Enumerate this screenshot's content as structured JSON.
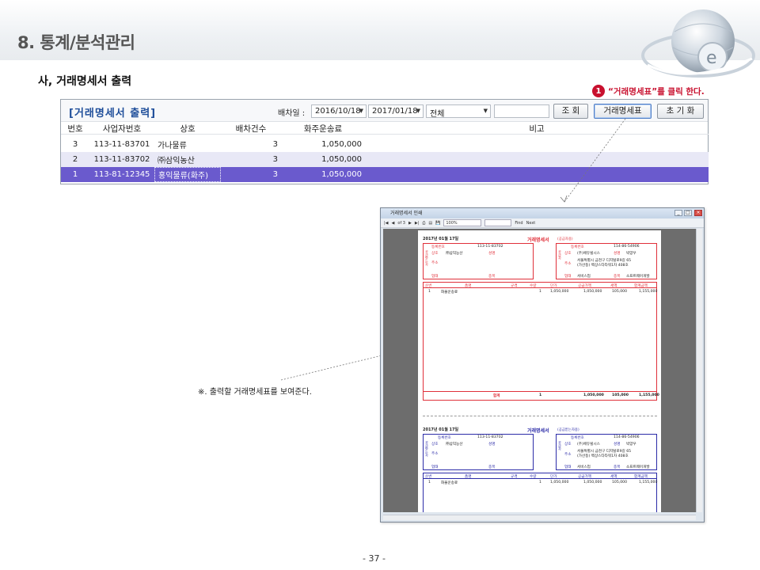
{
  "page": {
    "title": "8. 통계/분석관리",
    "section": "사, 거래명세서 출력",
    "callout_number": "1",
    "callout_text": "“거래명세표”를 클릭 한다.",
    "annotation": "※. 출력할 거래명세표를 보여준다.",
    "page_number": "- 37 -"
  },
  "app": {
    "title": "[거래명세서 출력]",
    "date_label": "배차일 :",
    "date_from": "2016/10/18",
    "date_to": "2017/01/18",
    "filter": "전체",
    "search_value": "",
    "btn_search": "조 회",
    "btn_invoice": "거래명세표",
    "btn_reset": "초 기 화",
    "columns": [
      "번호",
      "사업자번호",
      "상호",
      "배차건수",
      "화주운송료",
      "비고"
    ],
    "rows": [
      {
        "no": "3",
        "biz": "113-11-83701",
        "name": "가나물류",
        "count": "3",
        "fee": "1,050,000",
        "note": ""
      },
      {
        "no": "2",
        "biz": "113-11-83702",
        "name": "㈜삼익농산",
        "count": "3",
        "fee": "1,050,000",
        "note": ""
      },
      {
        "no": "1",
        "biz": "113-81-12345",
        "name": "홍익물류(화주)",
        "count": "3",
        "fee": "1,050,000",
        "note": ""
      }
    ],
    "selected_row": 2
  },
  "preview": {
    "window_title": "거래명세서 인쇄",
    "page_indicator": "of 3",
    "zoom": "100%",
    "find": "Find",
    "next": "Next",
    "invoices": [
      {
        "date": "2017년 01월 17일",
        "title": "거래명세서",
        "subtitle": "(공급자용)",
        "color": "#e0303a",
        "buyer_reg": "113-11-83702",
        "buyer_name": "㈜삼익농산",
        "supplier_reg": "114-86-54906",
        "supplier_name": "(주)에듀빌시스",
        "supplier_ceo": "박양우",
        "supplier_addr1": "서울특별시 금천구 디지털로9길 65",
        "supplier_addr2": "(가산동) 백상스타타워1차 408호",
        "supplier_type": "서비스업",
        "supplier_item": "소프트웨어개발",
        "line_no": "1",
        "line_item": "화물운송료",
        "line_qty": "1",
        "line_price": "1,050,000",
        "line_amount": "1,050,000",
        "line_tax": "105,000",
        "line_total": "1,155,000",
        "sum_label": "합계",
        "sum_qty": "1",
        "sum_amount": "1,050,000",
        "sum_tax": "105,000",
        "sum_total": "1,155,000"
      },
      {
        "date": "2017년 01월 17일",
        "title": "거래명세서",
        "subtitle": "(공급받는자용)",
        "color": "#2c2ca8",
        "buyer_reg": "113-11-83702",
        "buyer_name": "㈜삼익농산",
        "supplier_reg": "114-86-54906",
        "supplier_name": "(주)에듀빌시스",
        "supplier_ceo": "박양우",
        "supplier_addr1": "서울특별시 금천구 디지털로9길 65",
        "supplier_addr2": "(가산동) 백상스타타워1차 408호",
        "supplier_type": "서비스업",
        "supplier_item": "소프트웨어개발",
        "line_no": "1",
        "line_item": "화물운송료",
        "line_qty": "1",
        "line_price": "1,050,000",
        "line_amount": "1,050,000",
        "line_tax": "105,000",
        "line_total": "1,155,000"
      }
    ],
    "labels": {
      "reg": "등록번호",
      "name": "상호",
      "ceo": "성명",
      "addr": "주소",
      "type": "업태",
      "item": "종목",
      "buyer_side": "공급받는자",
      "supplier_side": "공급자",
      "col_no": "순번",
      "col_item": "품명",
      "col_spec": "규격",
      "col_qty": "수량",
      "col_price": "단가",
      "col_amount": "공급가액",
      "col_tax": "세액",
      "col_total": "합계금액"
    }
  },
  "colors": {
    "selected_row": "#6a5acd",
    "accent": "#c8102e",
    "title_blue": "#1f4e9a"
  }
}
